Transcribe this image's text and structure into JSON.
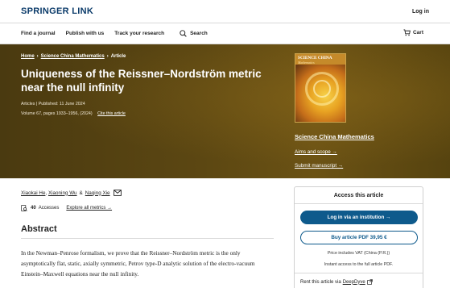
{
  "header": {
    "logo": "SPRINGER LINK",
    "login": "Log in"
  },
  "nav": {
    "find_journal": "Find a journal",
    "publish": "Publish with us",
    "track": "Track your research",
    "search": "Search",
    "cart": "Cart"
  },
  "hero": {
    "breadcrumb": {
      "home": "Home",
      "journal": "Science China Mathematics",
      "current": "Article"
    },
    "title": "Uniqueness of the Reissner–Nordström metric near the null infinity",
    "type": "Articles",
    "published": "Published: 11 June 2024",
    "volume": "Volume 67, pages 1933–1956, (2024)",
    "cite": "Cite this article",
    "cover": {
      "line1": "SCIENCE CHINA",
      "line2": "Mathematics"
    },
    "journal_link": "Science China Mathematics",
    "aims": "Aims and scope →",
    "submit": "Submit manuscript →"
  },
  "article": {
    "authors": [
      "Xiaokai He",
      "Xiaoning Wu",
      "Naqing Xie"
    ],
    "author_sep": ",",
    "author_amp": "&",
    "accesses_count": "40",
    "accesses_label": "Accesses",
    "explore_metrics": "Explore all metrics →",
    "abstract_heading": "Abstract",
    "abstract_text": "In the Newman–Penrose formalism, we prove that the Reissner–Nordström metric is the only asymptotically flat, static, axially symmetric, Petrov type-D analytic solution of the electro-vacuum Einstein–Maxwell equations near the null infinity."
  },
  "access": {
    "title": "Access this article",
    "institution_button": "Log in via an institution →",
    "buy_button": "Buy article PDF 39,95 €",
    "vat": "Price includes VAT (China (P.R.))",
    "instant": "Instant access to the full article PDF.",
    "rent_prefix": "Rent this article via",
    "rent_provider": "DeepDyve"
  },
  "colors": {
    "brand": "#0b3b6a",
    "hero_bg": "#5c4712",
    "primary_button": "#0e5a8c"
  }
}
